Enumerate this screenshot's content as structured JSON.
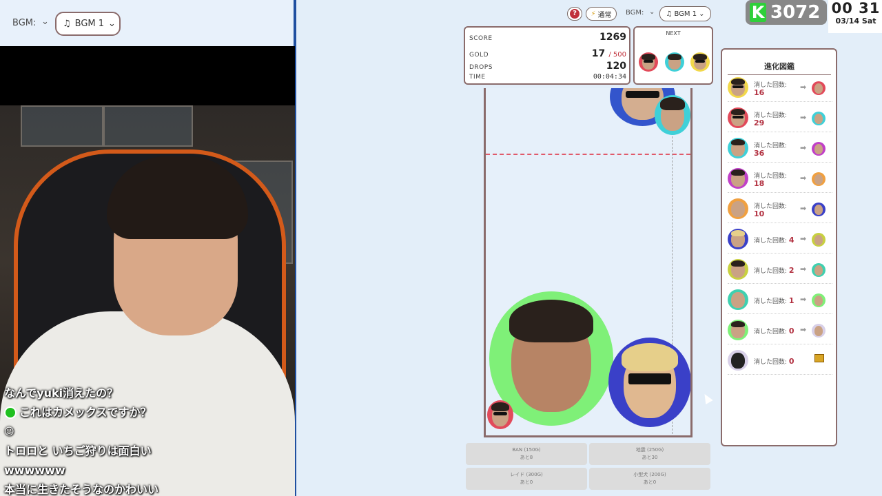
{
  "stream": {
    "bgm_label": "BGM:",
    "bgm_value": "BGM 1",
    "chat": [
      {
        "text": "なんでyuki消えたの？",
        "has_icon": false
      },
      {
        "text": "これはカメックスですか？",
        "has_icon": true
      },
      {
        "text": "",
        "has_icon": false
      },
      {
        "text": "トロロと いちご狩りは面白い",
        "has_icon": false
      },
      {
        "text": "wwwwww",
        "has_icon": false
      },
      {
        "text": "本当に生きたそうなのかわいい",
        "has_icon": false
      }
    ]
  },
  "game": {
    "help_label": "?",
    "mode_label": "通常",
    "bgm_label": "BGM:",
    "bgm_value": "BGM 1",
    "counter_value": "3072",
    "clock_time": "00 31",
    "clock_date": "03/14 Sat",
    "stats": {
      "score_label": "SCORE",
      "score": "1269",
      "gold_label": "GOLD",
      "gold": "17",
      "gold_max": "/ 500",
      "drops_label": "DROPS",
      "drops": "120",
      "time_label": "TIME",
      "time": "00:04:34"
    },
    "next_label": "NEXT",
    "evolution_title": "進化図鑑",
    "evolution": [
      {
        "label": "消した回数:",
        "count": "16",
        "inline": false
      },
      {
        "label": "消した回数:",
        "count": "29",
        "inline": false
      },
      {
        "label": "消した回数:",
        "count": "36",
        "inline": false
      },
      {
        "label": "消した回数:",
        "count": "18",
        "inline": false
      },
      {
        "label": "消した回数:",
        "count": "10",
        "inline": false
      },
      {
        "label": "消した回数:",
        "count": "4",
        "inline": true
      },
      {
        "label": "消した回数:",
        "count": "2",
        "inline": true
      },
      {
        "label": "消した回数:",
        "count": "1",
        "inline": true
      },
      {
        "label": "消した回数:",
        "count": "0",
        "inline": true
      },
      {
        "label": "消した回数:",
        "count": "0",
        "inline": true
      }
    ],
    "actions": [
      {
        "name": "BAN (150G)",
        "sub": "あと8"
      },
      {
        "name": "地震 (250G)",
        "sub": "あと30"
      },
      {
        "name": "レイド (300G)",
        "sub": "あと0"
      },
      {
        "name": "小型犬 (200G)",
        "sub": "あと0"
      }
    ]
  },
  "colors": {
    "accent_border": "#8a6b6b",
    "count_red": "#b23040",
    "k_green": "#2fcf3a",
    "danger_line": "#e05a6a"
  }
}
